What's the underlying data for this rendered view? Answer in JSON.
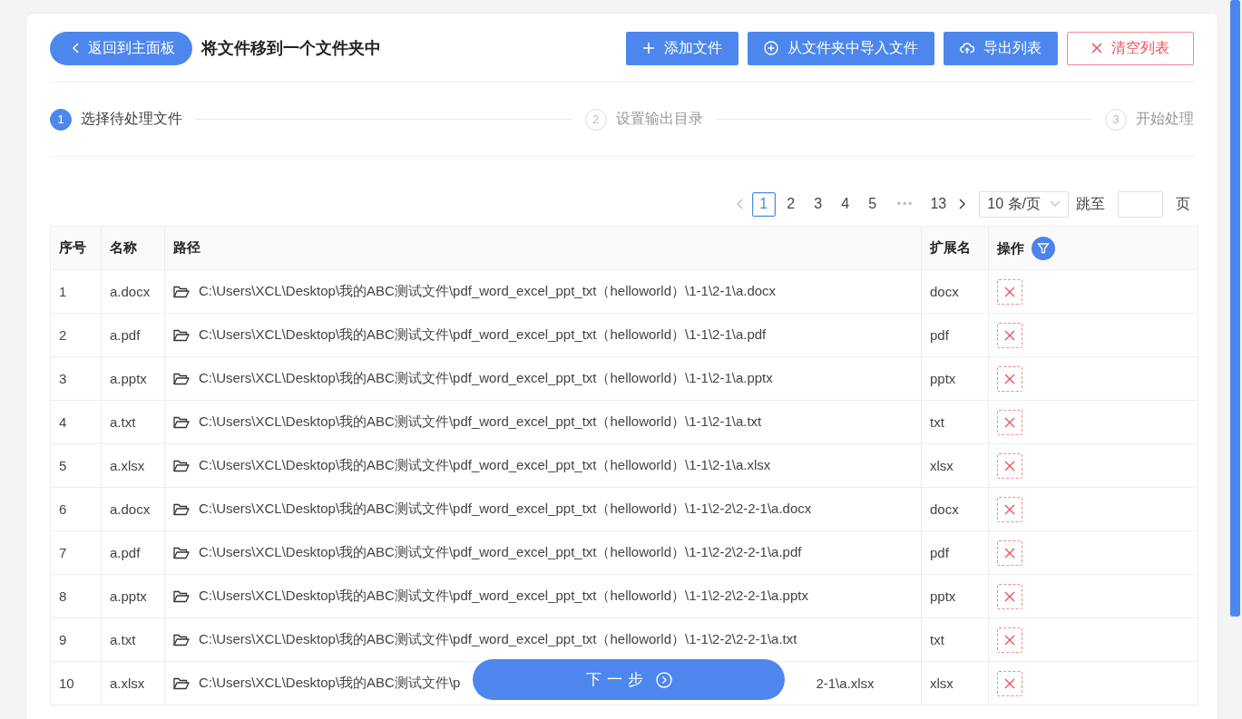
{
  "header": {
    "back_button": "返回到主面板",
    "title": "将文件移到一个文件夹中",
    "actions": [
      {
        "kind": "add",
        "label": "添加文件"
      },
      {
        "kind": "import",
        "label": "从文件夹中导入文件"
      },
      {
        "kind": "export",
        "label": "导出列表"
      },
      {
        "kind": "clear",
        "label": "清空列表"
      }
    ]
  },
  "steps": [
    {
      "number": "1",
      "label": "选择待处理文件",
      "selected": true
    },
    {
      "number": "2",
      "label": "设置输出目录",
      "selected": false
    },
    {
      "number": "3",
      "label": "开始处理",
      "selected": false
    }
  ],
  "pagination": {
    "prev_disabled": true,
    "next_disabled": false,
    "pages": [
      {
        "kind": "page",
        "label": "1",
        "selected": true
      },
      {
        "kind": "page",
        "label": "2",
        "selected": false
      },
      {
        "kind": "page",
        "label": "3",
        "selected": false
      },
      {
        "kind": "page",
        "label": "4",
        "selected": false
      },
      {
        "kind": "page",
        "label": "5",
        "selected": false
      },
      {
        "kind": "ellipsis",
        "label": "•••"
      },
      {
        "kind": "page",
        "label": "13",
        "selected": false
      }
    ],
    "page_size": "10 条/页",
    "jump_label": "跳至",
    "jump_suffix": "页"
  },
  "table": {
    "columns": [
      "序号",
      "名称",
      "路径",
      "扩展名",
      "操作"
    ],
    "rows": [
      {
        "index": "1",
        "name": "a.docx",
        "path": "C:\\Users\\XCL\\Desktop\\我的ABC测试文件\\pdf_word_excel_ppt_txt（helloworld）\\1-1\\2-1\\a.docx",
        "extension": "docx"
      },
      {
        "index": "2",
        "name": "a.pdf",
        "path": "C:\\Users\\XCL\\Desktop\\我的ABC测试文件\\pdf_word_excel_ppt_txt（helloworld）\\1-1\\2-1\\a.pdf",
        "extension": "pdf"
      },
      {
        "index": "3",
        "name": "a.pptx",
        "path": "C:\\Users\\XCL\\Desktop\\我的ABC测试文件\\pdf_word_excel_ppt_txt（helloworld）\\1-1\\2-1\\a.pptx",
        "extension": "pptx"
      },
      {
        "index": "4",
        "name": "a.txt",
        "path": "C:\\Users\\XCL\\Desktop\\我的ABC测试文件\\pdf_word_excel_ppt_txt（helloworld）\\1-1\\2-1\\a.txt",
        "extension": "txt"
      },
      {
        "index": "5",
        "name": "a.xlsx",
        "path": "C:\\Users\\XCL\\Desktop\\我的ABC测试文件\\pdf_word_excel_ppt_txt（helloworld）\\1-1\\2-1\\a.xlsx",
        "extension": "xlsx"
      },
      {
        "index": "6",
        "name": "a.docx",
        "path": "C:\\Users\\XCL\\Desktop\\我的ABC测试文件\\pdf_word_excel_ppt_txt（helloworld）\\1-1\\2-2\\2-2-1\\a.docx",
        "extension": "docx"
      },
      {
        "index": "7",
        "name": "a.pdf",
        "path": "C:\\Users\\XCL\\Desktop\\我的ABC测试文件\\pdf_word_excel_ppt_txt（helloworld）\\1-1\\2-2\\2-2-1\\a.pdf",
        "extension": "pdf"
      },
      {
        "index": "8",
        "name": "a.pptx",
        "path": "C:\\Users\\XCL\\Desktop\\我的ABC测试文件\\pdf_word_excel_ppt_txt（helloworld）\\1-1\\2-2\\2-2-1\\a.pptx",
        "extension": "pptx"
      },
      {
        "index": "9",
        "name": "a.txt",
        "path": "C:\\Users\\XCL\\Desktop\\我的ABC测试文件\\pdf_word_excel_ppt_txt（helloworld）\\1-1\\2-2\\2-2-1\\a.txt",
        "extension": "txt"
      },
      {
        "index": "10",
        "name": "a.xlsx",
        "path": "C:\\Users\\XCL\\Desktop\\我的ABC测试文件\\p",
        "path_tail": "2-1\\a.xlsx",
        "extension": "xlsx"
      }
    ]
  },
  "next_button": "下一步"
}
